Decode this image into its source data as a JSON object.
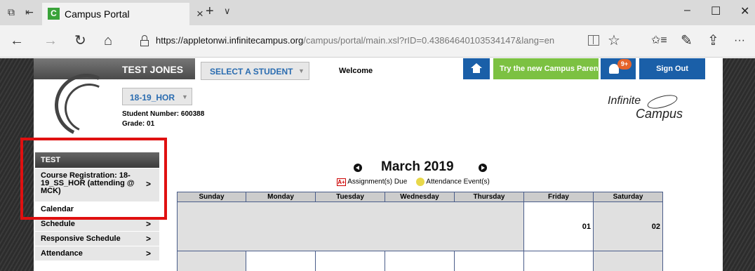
{
  "browser": {
    "tab_title": "Campus Portal",
    "tab_close": "×",
    "new_tab": "+",
    "tab_list": "∨",
    "win_minimize": "–",
    "win_maximize": "☐",
    "win_close": "✕",
    "url_host": "https://appletonwi.infinitecampus.org",
    "url_path": "/campus/portal/main.xsl?rID=0.43864640103534147&lang=en",
    "back": "←",
    "forward": "→",
    "refresh": "↻",
    "home": "⌂",
    "favorite": "☆",
    "favorites_list": "✩≡",
    "pen": "✎",
    "share": "⇪",
    "more": "···"
  },
  "header": {
    "student_name": "TEST JONES",
    "select_student": "SELECT A STUDENT",
    "welcome": "Welcome",
    "try_campus_parent": "Try the new Campus Parent",
    "notif_badge": "9+",
    "sign_out": "Sign Out",
    "term": "18-19_HOR",
    "student_number": "Student Number: 600388",
    "grade": "Grade: 01",
    "logo_word1": "Infinite",
    "logo_word2": "Campus"
  },
  "sidebar": {
    "heading": "TEST",
    "items": [
      {
        "label": "Course Registration: 18-19_SS_HOR (attending @ MCK)",
        "chevron": ">"
      },
      {
        "label": "Calendar",
        "chevron": ""
      },
      {
        "label": "Schedule",
        "chevron": ">"
      },
      {
        "label": "Responsive Schedule",
        "chevron": ">"
      },
      {
        "label": "Attendance",
        "chevron": ">"
      }
    ]
  },
  "calendar": {
    "month": "March 2019",
    "legend_assignments": "Assignment(s) Due",
    "legend_attendance": "Attendance Event(s)",
    "assign_icon_text": "A+",
    "days": [
      "Sunday",
      "Monday",
      "Tuesday",
      "Wednesday",
      "Thursday",
      "Friday",
      "Saturday"
    ],
    "week1": [
      "",
      "",
      "",
      "",
      "",
      "01",
      "02"
    ]
  },
  "colors": {
    "accent_blue": "#1a5fa8",
    "accent_green": "#7cc142",
    "badge_orange": "#e5642a",
    "highlight_red": "#e01010"
  }
}
